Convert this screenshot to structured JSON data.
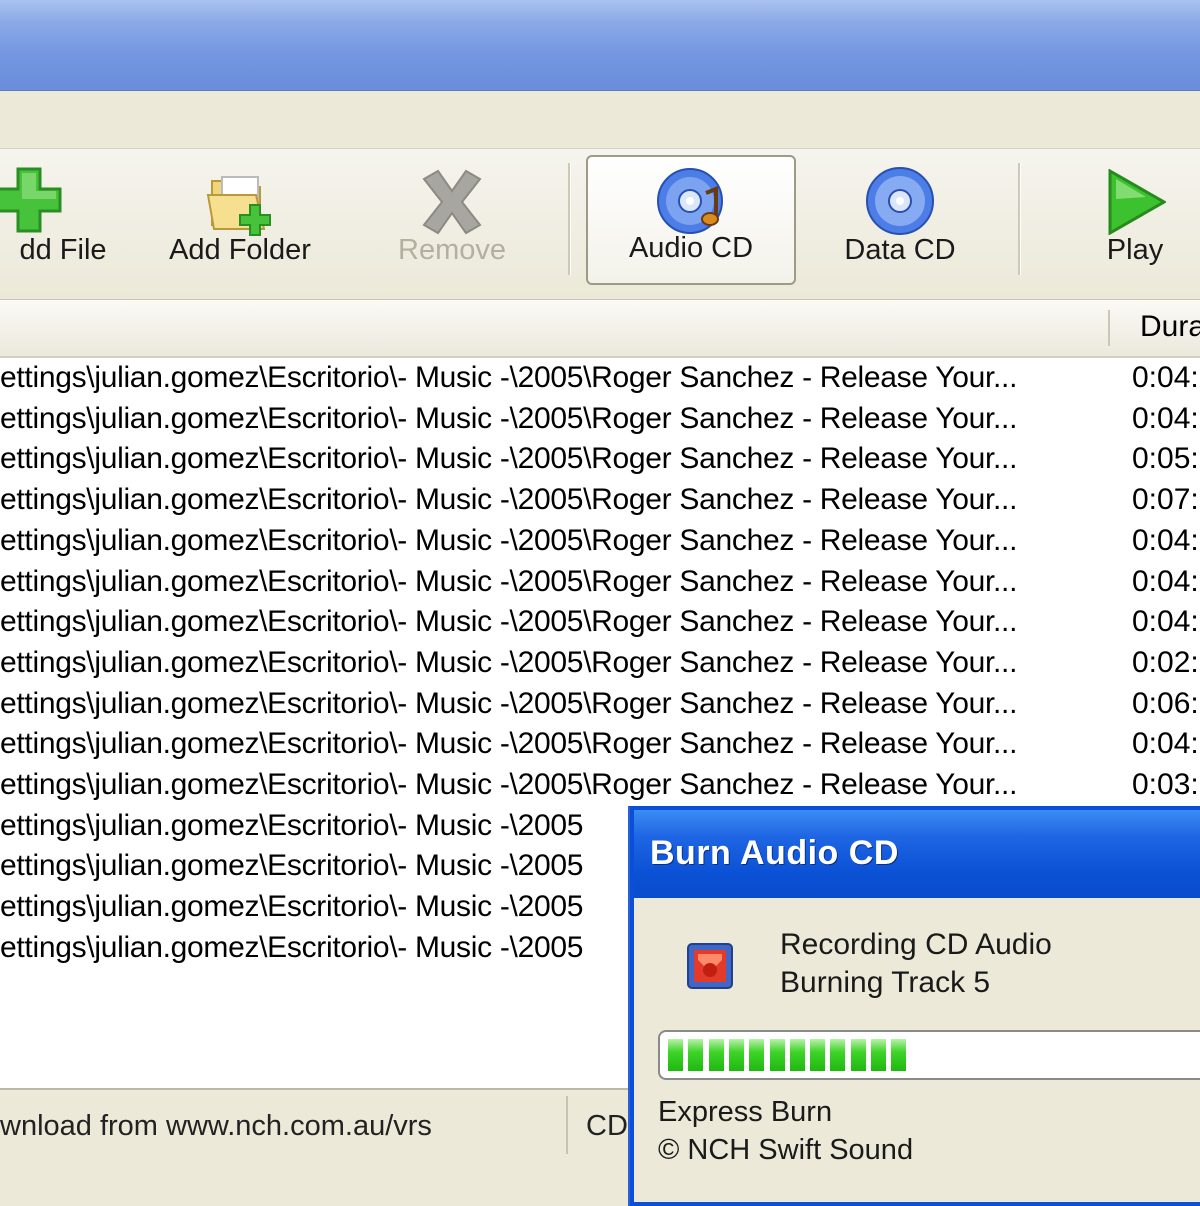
{
  "toolbar": {
    "add_file": "dd File",
    "add_folder": "Add Folder",
    "remove": "Remove",
    "audio_cd": "Audio CD",
    "data_cd": "Data CD",
    "play": "Play",
    "icons": {
      "add_file": "green-plus-icon",
      "add_folder": "folder-plus-icon",
      "remove": "gray-x-icon",
      "audio_cd": "audio-cd-icon",
      "data_cd": "data-cd-icon",
      "play": "play-triangle-icon"
    }
  },
  "list": {
    "columns": [
      "",
      "Dura"
    ],
    "rows": [
      {
        "path": "ettings\\julian.gomez\\Escritorio\\- Music -\\2005\\Roger Sanchez - Release Your...",
        "duration": "0:04:"
      },
      {
        "path": "ettings\\julian.gomez\\Escritorio\\- Music -\\2005\\Roger Sanchez - Release Your...",
        "duration": "0:04:"
      },
      {
        "path": "ettings\\julian.gomez\\Escritorio\\- Music -\\2005\\Roger Sanchez - Release Your...",
        "duration": "0:05:"
      },
      {
        "path": "ettings\\julian.gomez\\Escritorio\\- Music -\\2005\\Roger Sanchez - Release Your...",
        "duration": "0:07:"
      },
      {
        "path": "ettings\\julian.gomez\\Escritorio\\- Music -\\2005\\Roger Sanchez - Release Your...",
        "duration": "0:04:"
      },
      {
        "path": "ettings\\julian.gomez\\Escritorio\\- Music -\\2005\\Roger Sanchez - Release Your...",
        "duration": "0:04:"
      },
      {
        "path": "ettings\\julian.gomez\\Escritorio\\- Music -\\2005\\Roger Sanchez - Release Your...",
        "duration": "0:04:"
      },
      {
        "path": "ettings\\julian.gomez\\Escritorio\\- Music -\\2005\\Roger Sanchez - Release Your...",
        "duration": "0:02:"
      },
      {
        "path": "ettings\\julian.gomez\\Escritorio\\- Music -\\2005\\Roger Sanchez - Release Your...",
        "duration": "0:06:"
      },
      {
        "path": "ettings\\julian.gomez\\Escritorio\\- Music -\\2005\\Roger Sanchez - Release Your...",
        "duration": "0:04:"
      },
      {
        "path": "ettings\\julian.gomez\\Escritorio\\- Music -\\2005\\Roger Sanchez - Release Your...",
        "duration": "0:03:"
      },
      {
        "path": "ettings\\julian.gomez\\Escritorio\\- Music -\\2005",
        "duration": ""
      },
      {
        "path": "ettings\\julian.gomez\\Escritorio\\- Music -\\2005",
        "duration": ""
      },
      {
        "path": "ettings\\julian.gomez\\Escritorio\\- Music -\\2005",
        "duration": ""
      },
      {
        "path": "ettings\\julian.gomez\\Escritorio\\- Music -\\2005",
        "duration": ""
      }
    ]
  },
  "statusbar": {
    "message": "wnload from www.nch.com.au/vrs",
    "mode": "CD"
  },
  "dialog": {
    "title": "Burn Audio CD",
    "line1": "Recording CD Audio",
    "line2": "Burning Track 5",
    "progress_segments": 12,
    "footer1": "Express Burn",
    "footer2": "© NCH Swift Sound",
    "icon": "burn-cd-icon"
  },
  "colors": {
    "title_blue": "#0a4fd8",
    "progress_green": "#2fc81e",
    "toolbar_bg": "#ece9d8"
  }
}
